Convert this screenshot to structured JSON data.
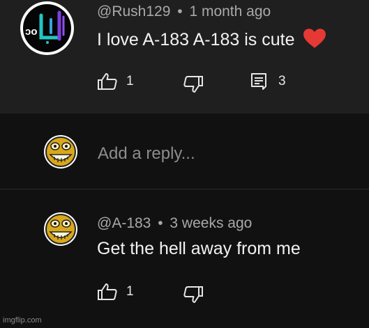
{
  "comment": {
    "author": "@Rush129",
    "separator": "•",
    "time": "1 month ago",
    "text": "I love A-183 A-183 is cute",
    "emoji": "heart",
    "likes": "1",
    "replies": "3"
  },
  "reply_box": {
    "placeholder": "Add a reply..."
  },
  "reply": {
    "author": "@A-183",
    "separator": "•",
    "time": "3 weeks ago",
    "text": "Get the hell away from me",
    "likes": "1"
  },
  "watermark": "imgflip.com",
  "colors": {
    "parent_background": "#1f1f1f",
    "page_background": "#111111",
    "heart": "#e53935",
    "meta_text": "#a9a9a9",
    "body_text": "#f2f2f2"
  },
  "icons": {
    "like": "thumbs-up-icon",
    "dislike": "thumbs-down-icon",
    "replies": "comment-icon"
  }
}
